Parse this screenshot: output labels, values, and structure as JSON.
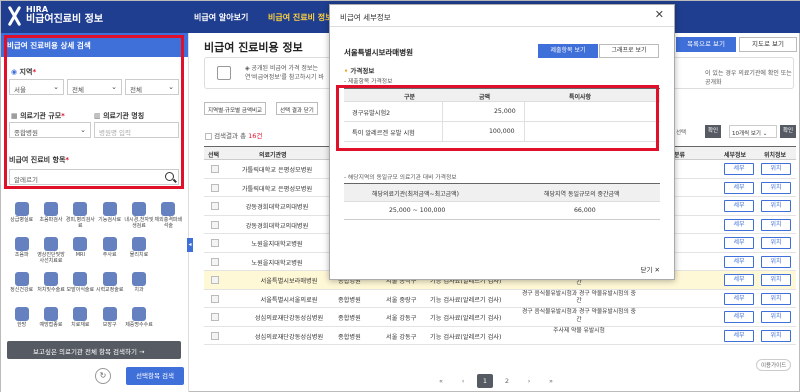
{
  "app": {
    "logo_line1": "HIRA",
    "logo_line2": "비급여진료비 정보"
  },
  "nav": {
    "items": [
      "비급여 알아보기",
      "비급여 진료비 정보"
    ],
    "active_index": 1
  },
  "sidebar": {
    "title": "비급여 진료비용 상세 검색",
    "region_label": "지역",
    "region_selects": [
      "서울",
      "전체",
      "전체"
    ],
    "scale_label": "의료기관 규모",
    "scale_value": "종합병원",
    "name_label": "의료기관 명칭",
    "name_placeholder": "병원명 입력",
    "item_label": "비급여 진료비 항목",
    "item_value": "알레르기",
    "categories": [
      "상급병실료",
      "초음파검사",
      "경피,병리검사료",
      "기능검사료",
      "내시경,천자및생검료",
      "체외충격파쇄석술",
      "조음파",
      "영상진단및방사선치료료",
      "MRI",
      "주사료",
      "물리치료",
      "",
      "정신건강료",
      "처치및수술료",
      "모발이식술료",
      "시력교정술료",
      "치과",
      "",
      "한방",
      "예방접종료",
      "치료재료",
      "보장구",
      "제증명수수료",
      ""
    ],
    "bottom_button": "보고싶은 의료기관 전체 항목 검색하기",
    "search_button": "선택항목 검색"
  },
  "main": {
    "title": "비급여 진료비용 정보",
    "list_view": "목록으로 보기",
    "map_view": "지도로 보기",
    "notice_text": "◈ 공개된 비급여 가격 정보는",
    "notice_text2": "연'비급여정보'를 참고하시기 바",
    "notice_right": "이 있는 경우 의료기관에 확인 또는 공개화",
    "tab_buttons": [
      "지역별·규모별 금액비교",
      "선택 결과 닫기"
    ],
    "result_count_prefix": "검색결과 총 ",
    "result_count": "16건",
    "right_controls": {
      "select": "선택",
      "confirm1": "확인",
      "page_size": "10개씩 보기",
      "confirm2": "확인"
    },
    "columns": [
      "선택",
      "의료기관명",
      "분류",
      "세부정보",
      "위치정보"
    ],
    "rows": [
      {
        "name": "가톨릭대학교 은평성모병원",
        "type": "",
        "loc": "",
        "item": "",
        "note": ""
      },
      {
        "name": "가톨릭대학교 은평성모병원",
        "type": "",
        "loc": "",
        "item": "",
        "note": ""
      },
      {
        "name": "강동경희대학교의대병원",
        "type": "",
        "loc": "",
        "item": "",
        "note": ""
      },
      {
        "name": "강동경희대학교의대병원",
        "type": "",
        "loc": "",
        "item": "",
        "note": ""
      },
      {
        "name": "노원을지대학교병원",
        "type": "",
        "loc": "",
        "item": "",
        "note": ""
      },
      {
        "name": "노원을지대학교병원",
        "type": "",
        "loc": "",
        "item": "",
        "note": ""
      },
      {
        "name": "서울특별시보라매병원",
        "type": "종합병원",
        "loc": "서울 동작구",
        "item": "기능 검사료(알레르기 검사)",
        "note": "경구 음식물유발시험과 경구 약물유발시험의 중간"
      },
      {
        "name": "서울특별시서울의료원",
        "type": "종합병원",
        "loc": "서울 중랑구",
        "item": "기능 검사료(알레르기 검사)",
        "note": "경구 음식물유발시험과 경구 약물유발시험의 중간"
      },
      {
        "name": "성심의료재단강동성심병원",
        "type": "종합병원",
        "loc": "서울 강동구",
        "item": "기능 검사료(알레르기 검사)",
        "note": "경구 음식물유발시험과 경구 약물유발시험의 중간"
      },
      {
        "name": "성심의료재단강동성심병원",
        "type": "종합병원",
        "loc": "서울 강동구",
        "item": "기능 검사료(알레르기 검사)",
        "note": "주사제 약물 유발시험"
      }
    ],
    "detail_btn": "세부",
    "loc_btn": "위치",
    "pages": [
      "«",
      "‹",
      "1",
      "2",
      "›",
      "»"
    ],
    "current_page": "1",
    "guide": "이용가이드"
  },
  "modal": {
    "title": "비급여 세부정보",
    "hospital": "서울특별시보라매병원",
    "tab_detail": "제출항목 보기",
    "tab_graph": "그래프로 보기",
    "section": "가격정보",
    "sub1": "- 제출항목 가격정보",
    "table1_headers": [
      "구분",
      "금액",
      "특이사항"
    ],
    "table1_rows": [
      {
        "label": "경구유발시험2",
        "price": "25,000",
        "note": ""
      },
      {
        "label": "특이 알레르겐 유발 시험",
        "price": "100,000",
        "note": ""
      }
    ],
    "sub2": "- 해당지역의 동일규모 의료기관 대비 가격정보",
    "table2_headers": [
      "해당의료기관(최저금액~최고금액)",
      "해당지역 동일규모의 중간금액"
    ],
    "table2_row": [
      "25,000 ~ 100,000",
      "66,000"
    ],
    "close": "닫기"
  }
}
